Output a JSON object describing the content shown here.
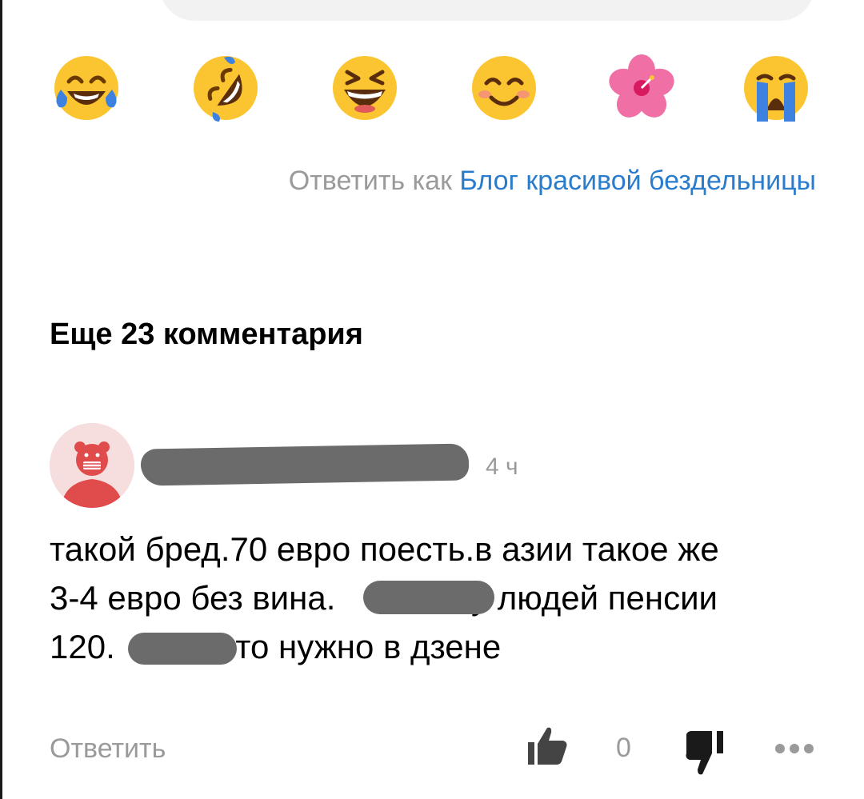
{
  "reaction_picker": {
    "emojis": [
      {
        "name": "face-with-tears-of-joy"
      },
      {
        "name": "rolling-on-the-floor-laughing"
      },
      {
        "name": "grinning-squinting-face"
      },
      {
        "name": "smiling-face-with-smiling-eyes"
      },
      {
        "name": "hibiscus"
      },
      {
        "name": "loudly-crying-face"
      }
    ]
  },
  "reply_as": {
    "prefix": "Ответить как",
    "blog_name": "Блог красивой бездельницы"
  },
  "more_comments": {
    "title": "Еще 23 комментария"
  },
  "comment": {
    "time": "4 ч",
    "body_line1": "такой бред.70 евро поесть.в азии такое же",
    "body_line2a": "3-4 евро без вина.",
    "body_line2b": ".у людей пенсии",
    "body_line3a": "120.",
    "body_line3b": "это нужно в дзене",
    "reply_label": "Ответить",
    "like_count": "0"
  },
  "colors": {
    "link_blue": "#2a7ccc",
    "muted_gray": "#9a9a9a",
    "redaction": "#6b6b6b",
    "avatar_bg": "#f7dede",
    "avatar_red": "#e04b4b"
  }
}
